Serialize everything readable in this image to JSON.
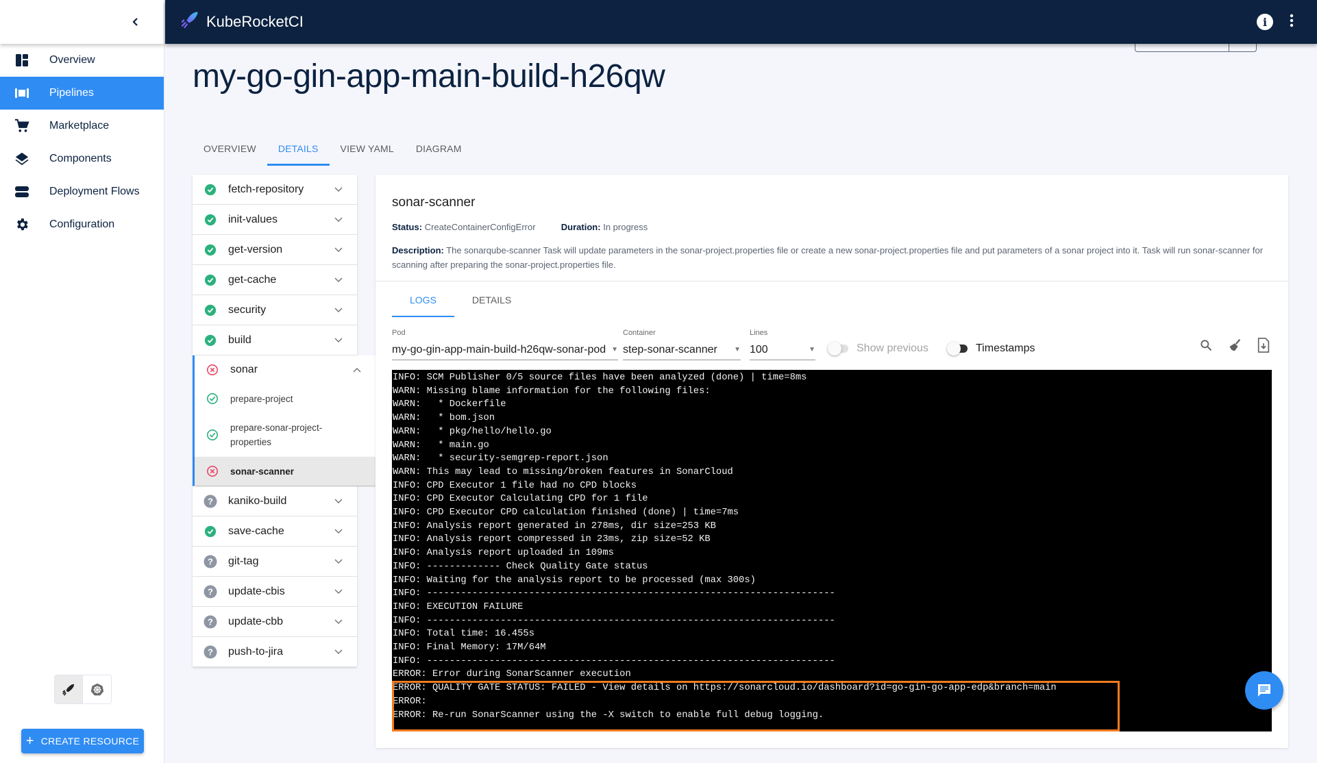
{
  "app": {
    "brand": "KubeRocketCI"
  },
  "sidebar": {
    "items": [
      {
        "label": "Overview",
        "icon": "dashboard-icon",
        "active": false
      },
      {
        "label": "Pipelines",
        "icon": "pipelines-icon",
        "active": true
      },
      {
        "label": "Marketplace",
        "icon": "cart-icon",
        "active": false
      },
      {
        "label": "Components",
        "icon": "layers-icon",
        "active": false
      },
      {
        "label": "Deployment Flows",
        "icon": "flows-icon",
        "active": false
      },
      {
        "label": "Configuration",
        "icon": "gear-icon",
        "active": false
      }
    ],
    "create_label": "CREATE RESOURCE"
  },
  "page": {
    "title": "my-go-gin-app-main-build-h26qw",
    "tabs": [
      "OVERVIEW",
      "DETAILS",
      "VIEW YAML",
      "DIAGRAM"
    ],
    "active_tab": "DETAILS"
  },
  "steps": [
    {
      "name": "fetch-repository",
      "status": "success"
    },
    {
      "name": "init-values",
      "status": "success"
    },
    {
      "name": "get-version",
      "status": "success"
    },
    {
      "name": "get-cache",
      "status": "success"
    },
    {
      "name": "security",
      "status": "success"
    },
    {
      "name": "build",
      "status": "success"
    },
    {
      "name": "sonar",
      "status": "failed",
      "expanded": true,
      "substeps": [
        {
          "name": "prepare-project",
          "status": "success"
        },
        {
          "name": "prepare-sonar-project-properties",
          "line1": "prepare-sonar-project-",
          "line2": "properties",
          "status": "success"
        },
        {
          "name": "sonar-scanner",
          "status": "failed",
          "selected": true
        }
      ]
    },
    {
      "name": "kaniko-build",
      "status": "unknown"
    },
    {
      "name": "save-cache",
      "status": "success"
    },
    {
      "name": "git-tag",
      "status": "unknown"
    },
    {
      "name": "update-cbis",
      "status": "unknown"
    },
    {
      "name": "update-cbb",
      "status": "unknown"
    },
    {
      "name": "push-to-jira",
      "status": "unknown"
    }
  ],
  "details": {
    "title": "sonar-scanner",
    "status_label": "Status:",
    "status_value": "CreateContainerConfigError",
    "duration_label": "Duration:",
    "duration_value": "In progress",
    "description_label": "Description:",
    "description_value": "The sonarqube-scanner Task will update parameters in the sonar-project.properties file or create a new sonar-project.properties file and put parameters of a sonar project into it. Task will run sonar-scanner for scanning after preparing the sonar-project.properties file.",
    "tabs": [
      "LOGS",
      "DETAILS"
    ],
    "active_tab": "LOGS"
  },
  "log_controls": {
    "pod_label": "Pod",
    "pod_value": "my-go-gin-app-main-build-h26qw-sonar-pod",
    "container_label": "Container",
    "container_value": "step-sonar-scanner",
    "lines_label": "Lines",
    "lines_value": "100",
    "show_previous_label": "Show previous",
    "show_previous_enabled": false,
    "timestamps_label": "Timestamps",
    "timestamps_on": false
  },
  "logs": [
    "INFO: SCM Publisher 0/5 source files have been analyzed (done) | time=8ms",
    "WARN: Missing blame information for the following files:",
    "WARN:   * Dockerfile",
    "WARN:   * bom.json",
    "WARN:   * pkg/hello/hello.go",
    "WARN:   * main.go",
    "WARN:   * security-semgrep-report.json",
    "WARN: This may lead to missing/broken features in SonarCloud",
    "INFO: CPD Executor 1 file had no CPD blocks",
    "INFO: CPD Executor Calculating CPD for 1 file",
    "INFO: CPD Executor CPD calculation finished (done) | time=7ms",
    "INFO: Analysis report generated in 278ms, dir size=253 KB",
    "INFO: Analysis report compressed in 23ms, zip size=52 KB",
    "INFO: Analysis report uploaded in 109ms",
    "INFO: ------------- Check Quality Gate status",
    "INFO: Waiting for the analysis report to be processed (max 300s)",
    "INFO: ------------------------------------------------------------------------",
    "INFO: EXECUTION FAILURE",
    "INFO: ------------------------------------------------------------------------",
    "INFO: Total time: 16.455s",
    "INFO: Final Memory: 17M/64M",
    "INFO: ------------------------------------------------------------------------",
    "ERROR: Error during SonarScanner execution",
    "ERROR: QUALITY GATE STATUS: FAILED - View details on https://sonarcloud.io/dashboard?id=go-gin-go-app-edp&branch=main",
    "ERROR: ",
    "ERROR: Re-run SonarScanner using the -X switch to enable full debug logging."
  ],
  "colors": {
    "primary": "#2f8cf3",
    "topbar": "#0c2240",
    "success": "#2bb17d",
    "failed": "#e94766",
    "unknown": "#8e95a3",
    "highlight": "#f47b20"
  }
}
